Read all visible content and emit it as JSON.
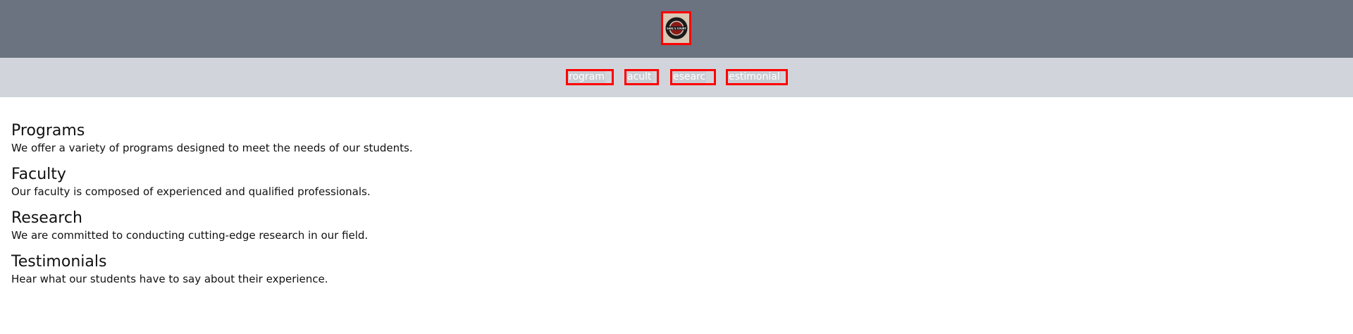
{
  "logo": {
    "text": "EARL'S COURT",
    "icon": "roundel-logo-icon"
  },
  "nav": {
    "items": [
      {
        "label": "Programs",
        "visible": "rogram"
      },
      {
        "label": "Faculty",
        "visible": "acult"
      },
      {
        "label": "Research",
        "visible": "esearc"
      },
      {
        "label": "Testimonials",
        "visible": "estimonial"
      }
    ]
  },
  "sections": [
    {
      "title": "Programs",
      "text": "We offer a variety of programs designed to meet the needs of our students."
    },
    {
      "title": "Faculty",
      "text": "Our faculty is composed of experienced and qualified professionals."
    },
    {
      "title": "Research",
      "text": "We are committed to conducting cutting-edge research in our field."
    },
    {
      "title": "Testimonials",
      "text": "Hear what our students have to say about their experience."
    }
  ],
  "colors": {
    "header_bg": "#6b7280",
    "nav_bg": "#d1d5db",
    "outline": "#ff0000"
  }
}
